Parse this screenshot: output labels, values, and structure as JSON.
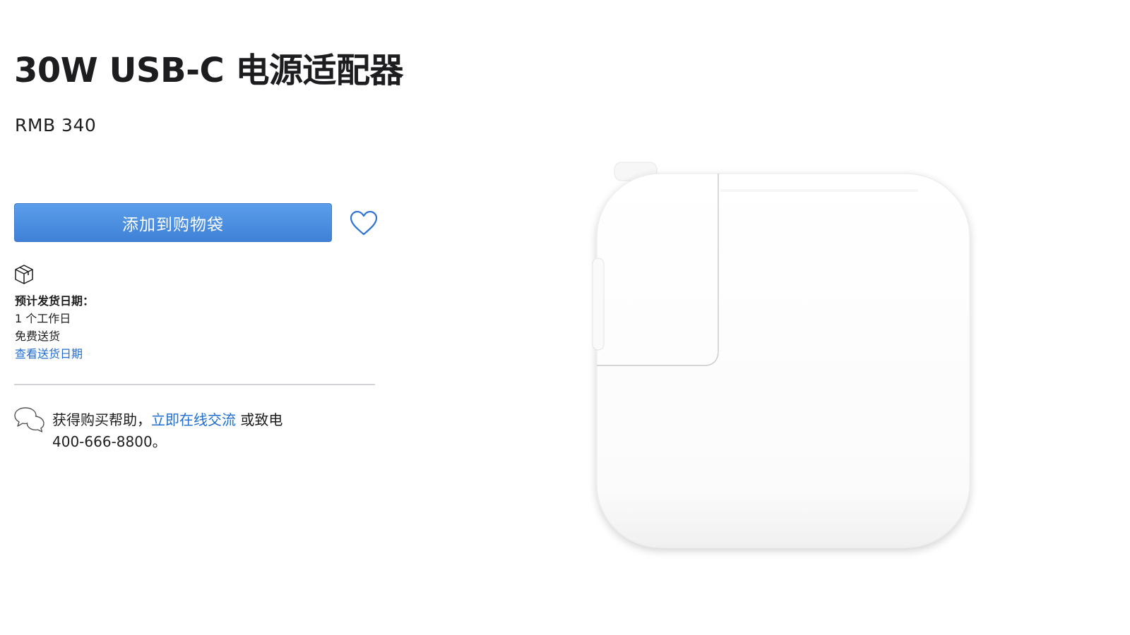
{
  "product": {
    "title": "30W USB-C 电源适配器",
    "price": "RMB 340"
  },
  "actions": {
    "add_to_bag_label": "添加到购物袋"
  },
  "shipping": {
    "label": "预计发货日期：",
    "days": "1 个工作日",
    "free_shipping": "免费送货",
    "view_dates_link": "查看送货日期"
  },
  "help": {
    "prefix": "获得购买帮助，",
    "chat_link": "立即在线交流",
    "middle": " 或致电",
    "phone": "400-666-8800。"
  },
  "icons": {
    "favorite": "heart-icon",
    "shipping": "box-icon",
    "help": "chat-bubbles-icon"
  },
  "colors": {
    "button_top": "#5b9eea",
    "button_bottom": "#3f81d7",
    "link": "#1f6dd1",
    "text": "#1d1d1f"
  }
}
